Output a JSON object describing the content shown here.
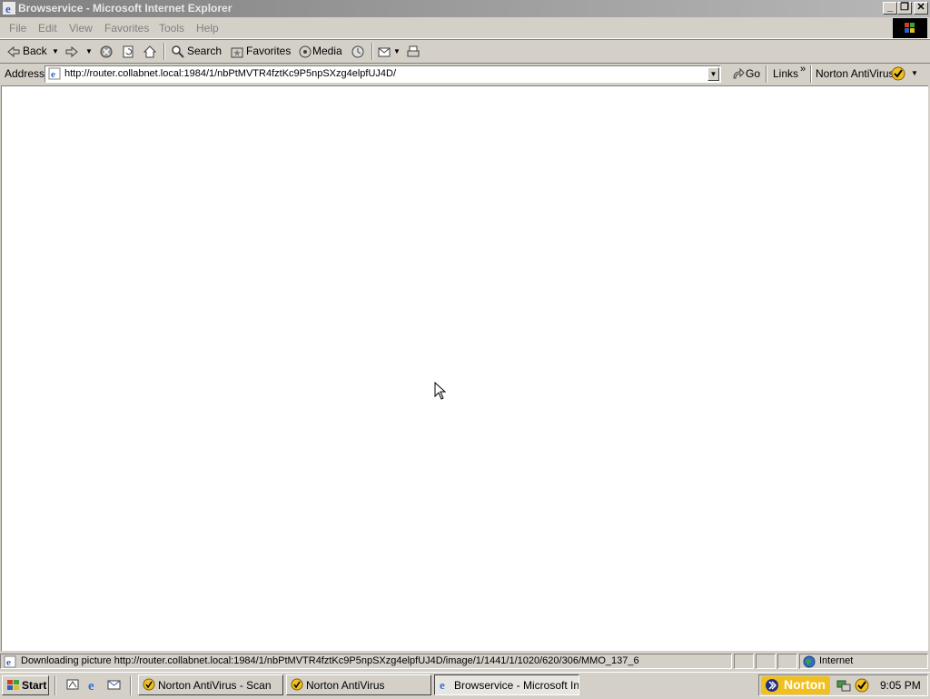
{
  "window": {
    "title": "Browservice - Microsoft Internet Explorer",
    "buttons": [
      "_",
      "❐",
      "✕"
    ]
  },
  "menu": {
    "items": [
      "File",
      "Edit",
      "View",
      "Favorites",
      "Tools",
      "Help"
    ]
  },
  "toolbar": {
    "back_label": "Back",
    "search_label": "Search",
    "favorites_label": "Favorites",
    "media_label": "Media"
  },
  "address": {
    "label": "Address",
    "url": "http://router.collabnet.local:1984/1/nbPtMVTR4fztKc9P5npSXzg4elpfUJ4D/",
    "go_label": "Go",
    "links_label": "Links",
    "norton_label": "Norton AntiVirus"
  },
  "status": {
    "text": "Downloading picture http://router.collabnet.local:1984/1/nbPtMVTR4fztKc9P5npSXzg4elpfUJ4D/image/1/1441/1/1020/620/306/MMO_137_6",
    "zone": "Internet"
  },
  "taskbar": {
    "start_label": "Start",
    "tasks": [
      {
        "label": "Norton AntiVirus - Scan"
      },
      {
        "label": "Norton AntiVirus"
      },
      {
        "label": "Browservice - Microsoft Int..."
      }
    ],
    "norton_brand": "Norton",
    "clock": "9:05 PM"
  },
  "colors": {
    "face": "#d4d0c8",
    "title_inactive": "#808080",
    "norton_yellow": "#f0c020"
  }
}
